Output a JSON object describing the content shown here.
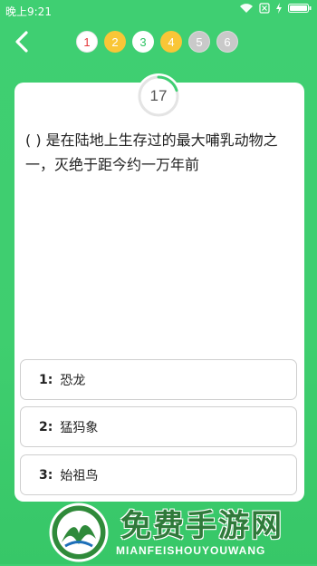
{
  "status_bar": {
    "time": "晚上9:21",
    "icons": [
      "wifi-icon",
      "sim-off-icon",
      "charging-icon",
      "battery-icon"
    ]
  },
  "header": {
    "back_icon": "chevron-left-icon",
    "progress": [
      {
        "label": "1",
        "state": "current"
      },
      {
        "label": "2",
        "state": "answered-yellow"
      },
      {
        "label": "3",
        "state": "answered-white"
      },
      {
        "label": "4",
        "state": "answered-yellow"
      },
      {
        "label": "5",
        "state": "locked"
      },
      {
        "label": "6",
        "state": "locked"
      }
    ]
  },
  "timer": {
    "value": "17",
    "fraction_remaining": 0.2
  },
  "question": {
    "text": "( ) 是在陆地上生存过的最大哺乳动物之一，灭绝于距今约一万年前"
  },
  "options": [
    {
      "number": "1:",
      "label": "恐龙"
    },
    {
      "number": "2:",
      "label": "猛犸象"
    },
    {
      "number": "3:",
      "label": "始祖鸟"
    }
  ],
  "watermark": {
    "title": "免费手游网",
    "subtitle": "MIANFEISHOUYOUWANG"
  },
  "colors": {
    "background": "#3fcf72",
    "accent_green": "#2fc464",
    "yellow": "#f9c637",
    "red": "#e5383b",
    "gray": "#c9c9c9"
  }
}
